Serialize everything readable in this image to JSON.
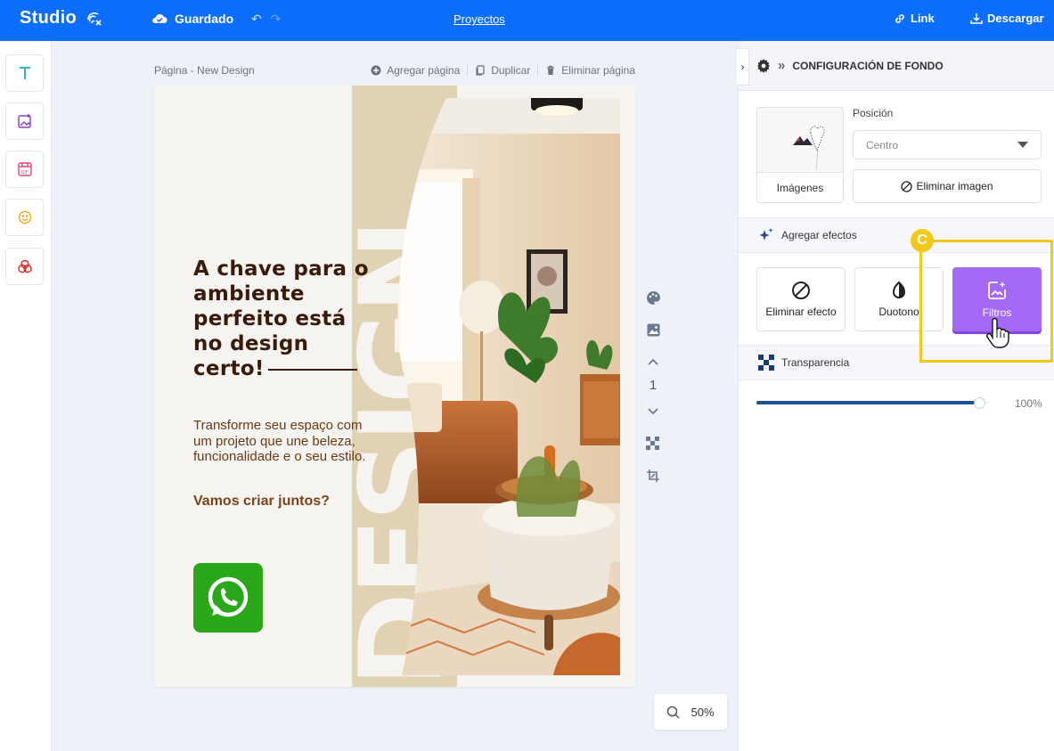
{
  "app": {
    "logo": "Studio",
    "saved_label": "Guardado",
    "projects_label": "Proyectos",
    "link_label": "Link",
    "download_label": "Descargar"
  },
  "page": {
    "title": "Página - New Design",
    "add_page": "Agregar página",
    "duplicate": "Duplicar",
    "delete_page": "Eliminar página",
    "number": "1",
    "zoom": "50%"
  },
  "design": {
    "vertical_word": "DESIGN",
    "headline": "A chave para o ambiente perfeito está no design certo!",
    "body": "Transforme seu espaço com um projeto que une beleza, funcionalidade e o seu estilo.",
    "cta": "Vamos criar juntos?"
  },
  "panel": {
    "title": "CONFIGURACIÓN DE FONDO",
    "images_label": "Imágenes",
    "position_label": "Posición",
    "position_value": "Centro",
    "remove_image": "Eliminar imagen",
    "effects_title": "Agregar efectos",
    "effects": [
      {
        "label": "Eliminar efecto",
        "icon": "ban-icon",
        "active": false
      },
      {
        "label": "Duotono",
        "icon": "contrast-icon",
        "active": false
      },
      {
        "label": "Filtros",
        "icon": "image-sparkle-icon",
        "active": true
      }
    ],
    "transparency_label": "Transparencia",
    "transparency_value": "100%",
    "transparency_fraction": 0.98
  },
  "annotation": {
    "marker": "C",
    "color": "#f2c81a"
  },
  "colors": {
    "topbar": "#0d6efd",
    "accent": "#a46af5",
    "slider": "#1d4f91"
  }
}
